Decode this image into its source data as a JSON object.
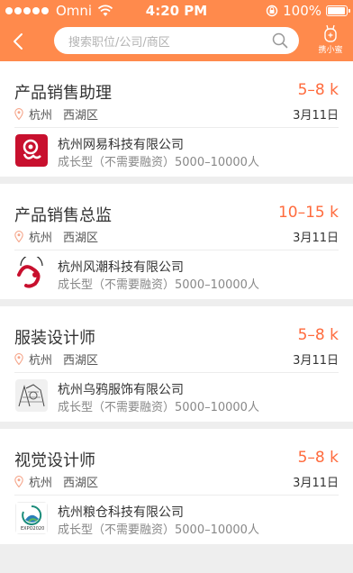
{
  "status_bar": {
    "carrier": "Omni",
    "time": "4:20 PM",
    "battery": "100%",
    "battery_level": 1.0
  },
  "nav": {
    "search_placeholder": "搜索职位/公司/商区",
    "assistant_label": "携小蜜",
    "colors": {
      "accent": "#ff8a4c",
      "salary": "#ff6b3d"
    }
  },
  "jobs": [
    {
      "title": "产品销售助理",
      "salary": "5–8 k",
      "city": "杭州",
      "district": "西湖区",
      "date": "3月11日",
      "company": "杭州网易科技有限公司",
      "company_info": "成长型（不需要融资）5000–10000人",
      "logo_icon": "netease-logo-icon"
    },
    {
      "title": "产品销售总监",
      "salary": "10–15 k",
      "city": "杭州",
      "district": "西湖区",
      "date": "3月11日",
      "company": "杭州风潮科技有限公司",
      "company_info": "成长型（不需要融资）5000–10000人",
      "logo_icon": "fengchao-logo-icon"
    },
    {
      "title": "服装设计师",
      "salary": "5–8 k",
      "city": "杭州",
      "district": "西湖区",
      "date": "3月11日",
      "company": "杭州乌鸦服饰有限公司",
      "company_info": "成长型（不需要融资）5000–10000人",
      "logo_icon": "sketch-logo-icon"
    },
    {
      "title": "视觉设计师",
      "salary": "5–8 k",
      "city": "杭州",
      "district": "西湖区",
      "date": "3月11日",
      "company": "杭州粮仓科技有限公司",
      "company_info": "成长型（不需要融资）5000–10000人",
      "logo_icon": "expo-logo-icon",
      "logo_text": "EXPO2020"
    }
  ]
}
